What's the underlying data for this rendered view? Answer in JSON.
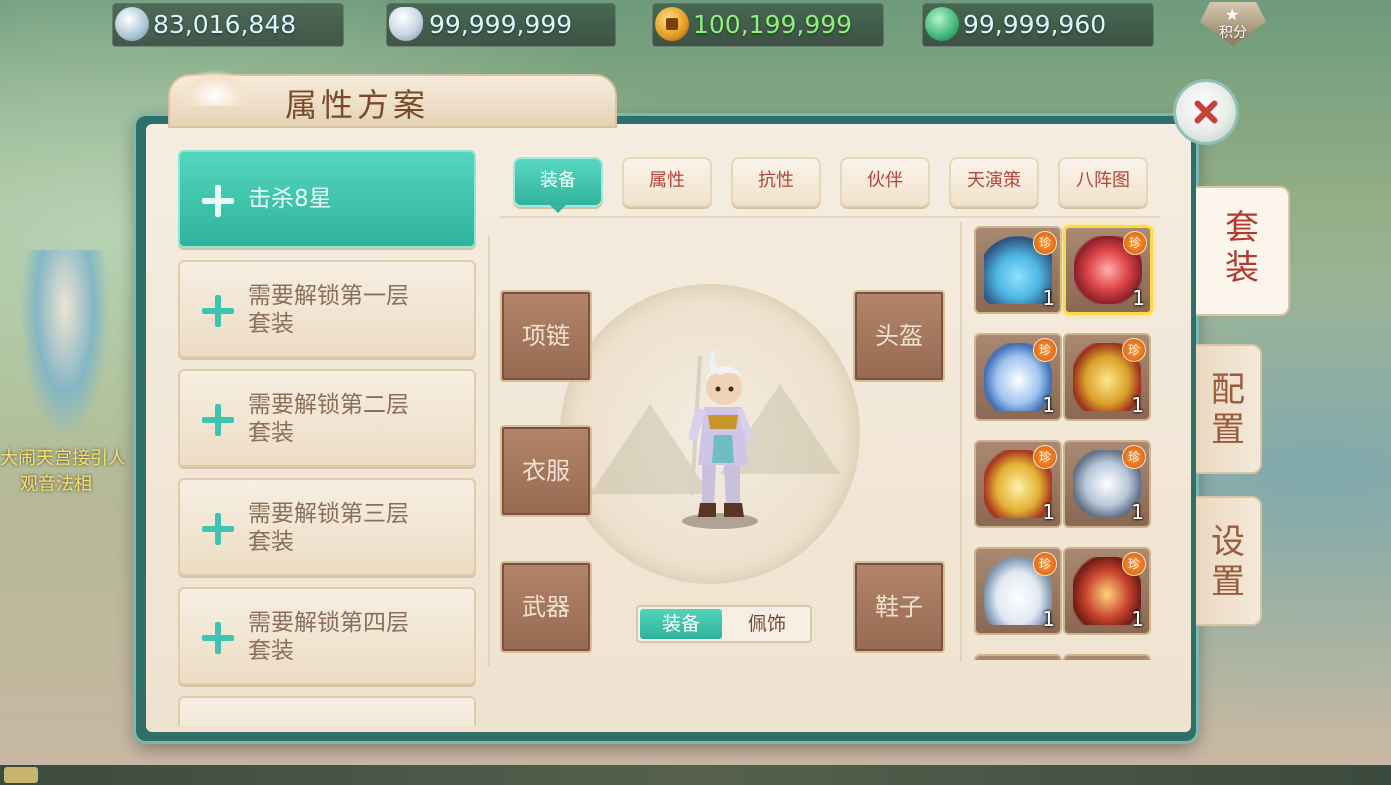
{
  "currencies": [
    {
      "icon": "silver-coin-icon",
      "value": "83,016,848"
    },
    {
      "icon": "silver-ingot-icon",
      "value": "99,999,999"
    },
    {
      "icon": "copper-coin-icon",
      "value": "100,199,999"
    },
    {
      "icon": "jade-plus-icon",
      "value": "99,999,960"
    }
  ],
  "score_button": {
    "label": "积分"
  },
  "background_labels": [
    "大闹天宫接引人",
    "观音法相"
  ],
  "panel": {
    "title": "属性方案"
  },
  "schemes": [
    {
      "label": "击杀8星",
      "active": true
    },
    {
      "label": "需要解锁第一层套装",
      "line1": "需要解锁第一层",
      "line2": "套装"
    },
    {
      "label": "需要解锁第二层套装",
      "line1": "需要解锁第二层",
      "line2": "套装"
    },
    {
      "label": "需要解锁第三层套装",
      "line1": "需要解锁第三层",
      "line2": "套装"
    },
    {
      "label": "需要解锁第四层套装",
      "line1": "需要解锁第四层",
      "line2": "套装"
    }
  ],
  "top_tabs": [
    "装备",
    "属性",
    "抗性",
    "伙伴",
    "天演策",
    "八阵图"
  ],
  "active_top_tab": "装备",
  "slots": {
    "necklace": "项链",
    "clothes": "衣服",
    "weapon": "武器",
    "helmet": "头盔",
    "shoes": "鞋子"
  },
  "equip_toggle": {
    "on": "装备",
    "off": "佩饰"
  },
  "side_tabs": [
    {
      "line1": "套",
      "line2": "装",
      "active": true
    },
    {
      "line1": "配",
      "line2": "置"
    },
    {
      "line1": "设",
      "line2": "置"
    }
  ],
  "item_badge": "珍",
  "items": [
    {
      "icon": "necklace-icon",
      "count": "1",
      "color": "#4fb7e3"
    },
    {
      "icon": "ruby-necklace-icon",
      "count": "1",
      "color": "#e0474a",
      "selected": true
    },
    {
      "icon": "blue-robe-icon",
      "count": "1",
      "color": "#9fc4f0"
    },
    {
      "icon": "gold-armor-icon",
      "count": "1",
      "color": "#d9a12a"
    },
    {
      "icon": "gold-helmet-icon",
      "count": "1",
      "color": "#e2b033"
    },
    {
      "icon": "silver-helmet-icon",
      "count": "1",
      "color": "#b9c7d9"
    },
    {
      "icon": "silver-boots-icon",
      "count": "1",
      "color": "#dfe8f2"
    },
    {
      "icon": "red-gold-armor-icon",
      "count": "1",
      "color": "#c9432f"
    }
  ]
}
